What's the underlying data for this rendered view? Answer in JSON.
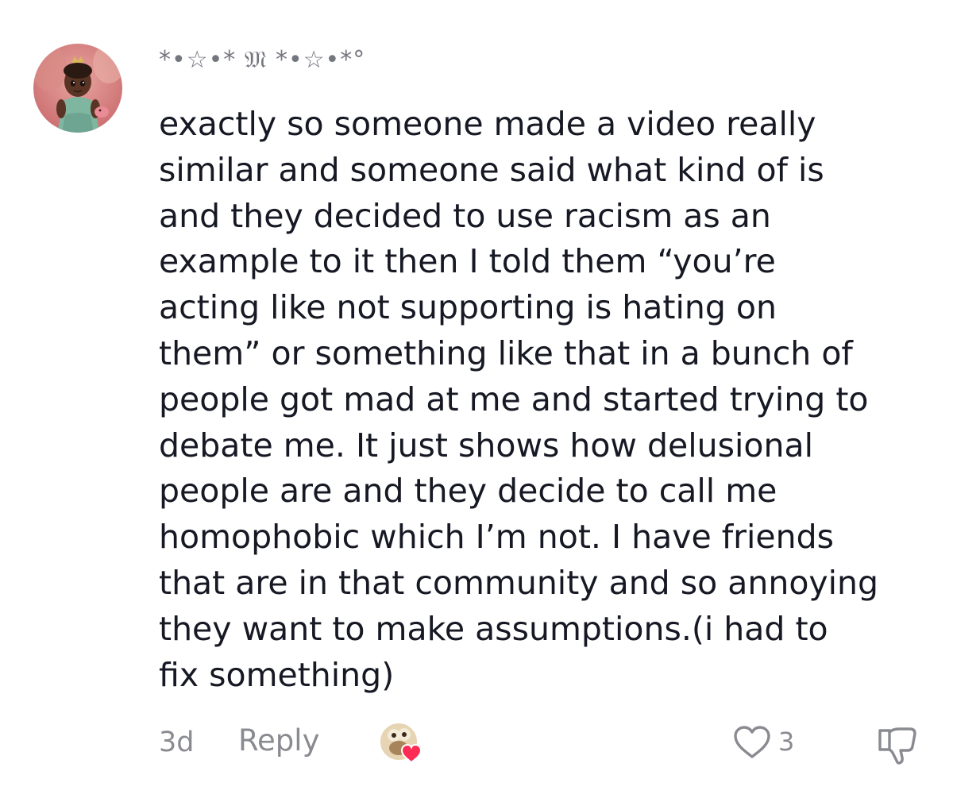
{
  "comment": {
    "username": "*•☆•* 𝔐 *•☆•*°",
    "text": "exactly so someone made a video really\nsimilar and someone said what kind of is\nand they decided to use racism as an\nexample to it then I told them “you’re\nacting like not supporting is hating on\nthem” or something like that in a bunch of\npeople got mad at me and started trying to\ndebate me. It just shows how delusional\npeople are and they decide to call me\nhomophobic which I’m not. I have friends\nthat are in that community and so annoying\nthey want to make assumptions.(i had to\nfix something)",
    "timestamp": "3d",
    "reply_label": "Reply",
    "like_count": "3"
  },
  "icons": {
    "avatar": "user-avatar",
    "creator_liked": "creator-liked-heart-icon",
    "like": "heart-outline-icon",
    "dislike": "thumbs-down-icon"
  },
  "colors": {
    "text": "#161823",
    "secondary": "#8a8b91",
    "heart_badge": "#fe2c55"
  }
}
